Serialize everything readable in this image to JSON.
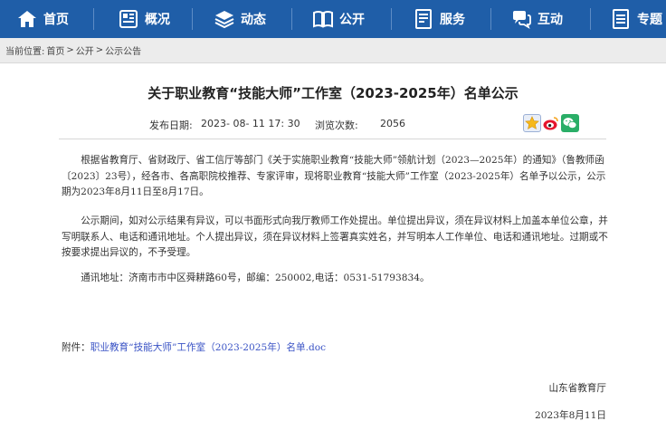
{
  "nav": {
    "items": [
      {
        "label": "首页",
        "icon": "home-icon"
      },
      {
        "label": "概况",
        "icon": "grid-icon"
      },
      {
        "label": "动态",
        "icon": "stack-icon"
      },
      {
        "label": "公开",
        "icon": "book-icon"
      },
      {
        "label": "服务",
        "icon": "document-icon"
      },
      {
        "label": "互动",
        "icon": "chat-icon"
      },
      {
        "label": "专题",
        "icon": "list-icon"
      }
    ]
  },
  "breadcrumb": {
    "prefix": "当前位置:",
    "items": [
      "首页",
      "公开",
      "公示公告"
    ],
    "separator": ">"
  },
  "article": {
    "title": "关于职业教育“技能大师”工作室（2023-2025年）名单公示",
    "publish_label": "发布日期:",
    "publish_value": "2023- 08- 11 17: 30",
    "views_label": "浏览次数:",
    "views_value": "2056",
    "paragraphs": [
      "根据省教育厅、省财政厅、省工信厅等部门《关于实施职业教育“技能大师”领航计划（2023—2025年）的通知》（鲁教师函〔2023〕23号），经各市、各高职院校推荐、专家评审，现将职业教育“技能大师”工作室（2023-2025年）名单予以公示，公示期为2023年8月11日至8月17日。",
      "公示期间，如对公示结果有异议，可以书面形式向我厅教师工作处提出。单位提出异议，须在异议材料上加盖本单位公章，并写明联系人、电话和通讯地址。个人提出异议，须在异议材料上签署真实姓名，并写明本人工作单位、电话和通讯地址。过期或不按要求提出异议的，不予受理。",
      "通讯地址：济南市市中区舜耕路60号，邮编：250002,电话：0531-51793834。"
    ],
    "attachment_label": "附件：",
    "attachment_link": "职业教育“技能大师”工作室（2023-2025年）名单.doc",
    "signature": "山东省教育厅",
    "sign_date": "2023年8月11日"
  },
  "colors": {
    "nav_bg": "#1f5ea8",
    "link": "#3a53c5"
  }
}
